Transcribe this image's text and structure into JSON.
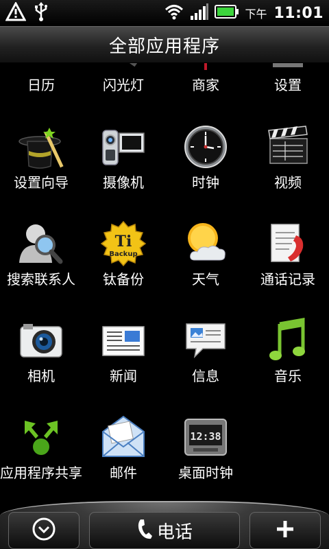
{
  "status_bar": {
    "icons_left": [
      "warning-icon",
      "usb-icon"
    ],
    "icons_right": [
      "wifi-icon",
      "signal-icon",
      "battery-icon"
    ],
    "ampm": "下午",
    "time": "11:01"
  },
  "title": "全部应用程序",
  "apps": [
    {
      "label": "日历",
      "icon": "calendar-icon"
    },
    {
      "label": "闪光灯",
      "icon": "flashlight-icon"
    },
    {
      "label": "商家",
      "icon": "market-icon"
    },
    {
      "label": "设置",
      "icon": "settings-icon"
    },
    {
      "label": "设置向导",
      "icon": "setup-wizard-icon"
    },
    {
      "label": "摄像机",
      "icon": "camcorder-icon"
    },
    {
      "label": "时钟",
      "icon": "clock-icon"
    },
    {
      "label": "视频",
      "icon": "video-icon"
    },
    {
      "label": "搜索联系人",
      "icon": "search-contacts-icon"
    },
    {
      "label": "钛备份",
      "icon": "titanium-backup-icon"
    },
    {
      "label": "天气",
      "icon": "weather-icon"
    },
    {
      "label": "通话记录",
      "icon": "call-log-icon"
    },
    {
      "label": "相机",
      "icon": "camera-icon"
    },
    {
      "label": "新闻",
      "icon": "news-icon"
    },
    {
      "label": "信息",
      "icon": "messages-icon"
    },
    {
      "label": "音乐",
      "icon": "music-icon"
    },
    {
      "label": "应用程序共享",
      "icon": "app-share-icon"
    },
    {
      "label": "邮件",
      "icon": "mail-icon"
    },
    {
      "label": "桌面时钟",
      "icon": "desk-clock-icon"
    }
  ],
  "app_row_0_clock_reading": "12:38",
  "dock": {
    "phone_label": "电话",
    "left_icon": "collapse-icon",
    "right_icon": "add-icon"
  }
}
